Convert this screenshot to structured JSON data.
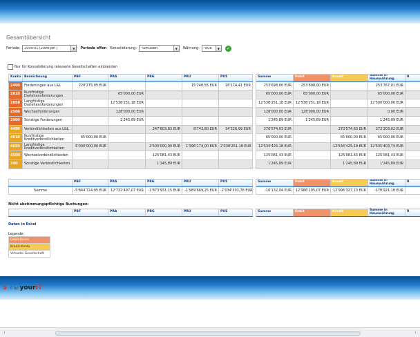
{
  "page": {
    "title": "Gesamtübersicht",
    "filters": {
      "periode_label": "Periode:",
      "periode_value": "2009-01 (2009 Jan )",
      "periode_status": "Periode offen",
      "konsolidierung_label": "Konsolidierung:",
      "konsolidierung_value": "\"Schulden",
      "waehrung_label": "Währung:",
      "waehrung_value": "\"EUR"
    },
    "checkbox_label": "Nur für Konsolidierung relevante Gesellschaften einblenden"
  },
  "table": {
    "headers": [
      "Konto",
      "Bezeichnung",
      "PBF",
      "PRA",
      "PRG",
      "PRU",
      "PUS",
      "Summe",
      "Debit",
      "Kredit",
      "Summe in Hauswährung",
      "R"
    ],
    "rows": [
      {
        "konto": "2400",
        "type": "debit",
        "bez": "Forderungen aus L&L",
        "pbf": "220'275,05 EUR",
        "pra": "",
        "prg": "",
        "pru": "15'248,55 EUR",
        "pus": "18'174,41 EUR",
        "summe": "253'698,00 EUR",
        "debit": "253'698,00 EUR",
        "kredit": "",
        "haus": "253'767,01 EUR"
      },
      {
        "konto": "2810",
        "type": "debit",
        "bez": "Kurzfristige Darlehensforderungen",
        "pbf": "",
        "pra": "65'000,00 EUR",
        "prg": "",
        "pru": "",
        "pus": "",
        "summe": "65'000,00 EUR",
        "debit": "65'000,00 EUR",
        "kredit": "",
        "haus": "65'000,00 EUR"
      },
      {
        "konto": "2850",
        "type": "debit",
        "bez": "Langfristige Darlehensforderungen",
        "pbf": "",
        "pra": "12'538'251,18 EUR",
        "prg": "",
        "pru": "",
        "pus": "",
        "summe": "12'538'251,18 EUR",
        "debit": "12'538'251,18 EUR",
        "kredit": "",
        "haus": "12'500'000,00 EUR"
      },
      {
        "konto": "2500",
        "type": "debit",
        "bez": "Wechselforderungen",
        "pbf": "",
        "pra": "128'000,00 EUR",
        "prg": "",
        "pru": "",
        "pus": "",
        "summe": "128'000,00 EUR",
        "debit": "128'000,00 EUR",
        "kredit": "",
        "haus": "0,00 EUR"
      },
      {
        "konto": "2900",
        "type": "debit",
        "bez": "Sonstige Forderungen",
        "pbf": "",
        "pra": "1'245,89 EUR",
        "prg": "",
        "pru": "",
        "pus": "",
        "summe": "1'245,89 EUR",
        "debit": "1'245,89 EUR",
        "kredit": "",
        "haus": "1'245,89 EUR"
      },
      {
        "konto": "4400",
        "type": "kredit",
        "bez": "Verbindlichkeiten aus L&L",
        "pbf": "",
        "pra": "",
        "prg": "247'603,83 EUR",
        "pru": "8'743,80 EUR",
        "pus": "14'226,99 EUR",
        "summe": "270'574,63 EUR",
        "debit": "",
        "kredit": "270'574,63 EUR",
        "haus": "272'203,02 EUR"
      },
      {
        "konto": "4610",
        "type": "kredit",
        "bez": "Kurzfristige Kreditverbindlichkeiten",
        "pbf": "65'000,00 EUR",
        "pra": "",
        "prg": "",
        "pru": "",
        "pus": "",
        "summe": "65'000,00 EUR",
        "debit": "",
        "kredit": "65'000,00 EUR",
        "haus": "65'000,00 EUR"
      },
      {
        "konto": "4650",
        "type": "kredit",
        "bez": "Langfristige Kreditverbindlichkeiten",
        "pbf": "6'000'000,00 EUR",
        "pra": "",
        "prg": "2'500'000,00 EUR",
        "pru": "1'996'174,00 EUR",
        "pus": "2'038'251,18 EUR",
        "summe": "12'534'425,18 EUR",
        "debit": "",
        "kredit": "12'534'425,18 EUR",
        "haus": "12'535'403,74 EUR"
      },
      {
        "konto": "4500",
        "type": "kredit",
        "bez": "Wechselverbindlichkeiten",
        "pbf": "",
        "pra": "",
        "prg": "125'081,43 EUR",
        "pru": "",
        "pus": "",
        "summe": "125'081,43 EUR",
        "debit": "",
        "kredit": "125'081,43 EUR",
        "haus": "125'081,43 EUR"
      },
      {
        "konto": "340",
        "type": "kredit",
        "bez": "Sonstige Verbindlichkeiten",
        "pbf": "",
        "pra": "",
        "prg": "1'245,89 EUR",
        "pru": "",
        "pus": "",
        "summe": "1'245,89 EUR",
        "debit": "",
        "kredit": "1'245,89 EUR",
        "haus": "1'245,89 EUR"
      }
    ]
  },
  "sum_table": {
    "headers": [
      "PBF",
      "PRA",
      "PRG",
      "PRU",
      "PUS",
      "Summe",
      "Debit",
      "Kredit",
      "Summe in Hauswährung",
      "R"
    ],
    "label": "Summe",
    "values": [
      "-5'844'724,95 EUR",
      "12'732'497,07 EUR",
      "-2'873'931,15 EUR",
      "-1'989'669,25 EUR",
      "-2'034'303,76 EUR",
      "-10'132,04 EUR",
      "12'986'195,07 EUR",
      "12'996'327,13 EUR",
      "-178'921,18 EUR"
    ]
  },
  "not_matched": {
    "title": "Nicht abstimmungspflichtige Buchungen:",
    "headers": [
      "PBF",
      "PRA",
      "PRG",
      "PRU",
      "PUS",
      "Summe",
      "Debit",
      "Kredit",
      "Summe in Hauswährung",
      "R"
    ]
  },
  "excel_link": "Daten in Excel",
  "legend": {
    "title": "Legende:",
    "debit": "Debit-Konto",
    "kredit": "Kredit-Konto",
    "virtual": "Virtuelle Gesellschaft"
  },
  "footer": {
    "mark": "S",
    "by": "© by",
    "brand_main": "your",
    "brand_accent": "IT"
  },
  "colors": {
    "debit": "#f0936a",
    "kredit": "#f7ca55",
    "konto_debit": "#e56b2d",
    "konto_kredit": "#e9a626",
    "band": "#1e78c8"
  }
}
